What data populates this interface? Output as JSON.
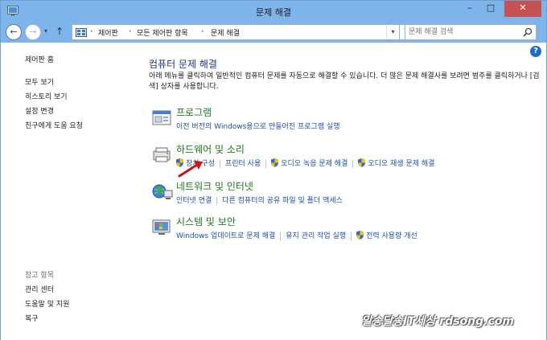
{
  "window": {
    "title": "문제 해결",
    "controls": {
      "minimize": "–",
      "maximize": "□",
      "close": "✕"
    }
  },
  "addressbar": {
    "breadcrumbs": [
      "제어판",
      "모든 제어판 항목",
      "문제 해결"
    ],
    "search_placeholder": "문제 해결 검색"
  },
  "left_nav": {
    "links": [
      "제어판 홈",
      "모두 보기",
      "히스토리 보기",
      "설정 변경",
      "친구에게 도움 요청"
    ],
    "see_also_heading": "참고 항목",
    "see_also": [
      "관리 센터",
      "도움말 및 지원",
      "복구"
    ]
  },
  "help_icon": "?",
  "main": {
    "heading": "컴퓨터 문제 해결",
    "description": "아래 메뉴를 클릭하여 일반적인 컴퓨터 문제를 자동으로 해결할 수 있습니다. 더 많은 문제 해결사를 보려면 범주를 클릭하거나 [검색] 상자를 사용합니다.",
    "categories": [
      {
        "title": "프로그램",
        "icon": "programs-icon",
        "links": [
          "이전 버전의 Windows용으로 만들어진 프로그램 실행"
        ]
      },
      {
        "title": "하드웨어 및 소리",
        "icon": "hardware-sound-icon",
        "links": [
          "장치 구성",
          "프린터 사용",
          "오디오 녹음 문제 해결",
          "오디오 재생 문제 해결"
        ]
      },
      {
        "title": "네트워크 및 인터넷",
        "icon": "network-internet-icon",
        "links": [
          "인터넷 연결",
          "다른 컴퓨터의 공유 파일 및 폴더 액세스"
        ]
      },
      {
        "title": "시스템 및 보안",
        "icon": "system-security-icon",
        "links": [
          "Windows 업데이트로 문제 해결",
          "유지 관리 작업 실행",
          "전력 사용량 개선"
        ]
      }
    ]
  },
  "watermark": "알송달송IT세상 rdsong.com",
  "colors": {
    "titlebar": "#7eb4ea",
    "heading": "#1e3287",
    "category": "#1e7a1e",
    "link": "#1c4fa8",
    "close": "#c75050",
    "arrow": "#cc1111"
  }
}
